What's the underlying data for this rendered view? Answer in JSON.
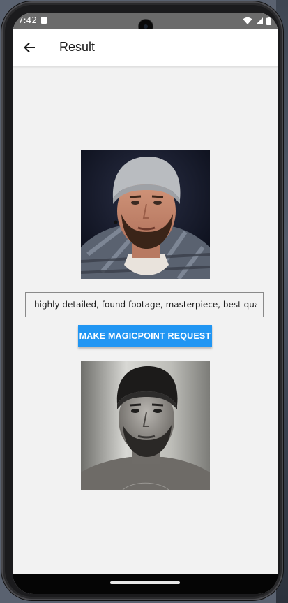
{
  "statusbar": {
    "time": "7:42",
    "icons": [
      "sim-card-icon",
      "wifi-icon",
      "signal-icon",
      "battery-icon"
    ]
  },
  "appbar": {
    "back_icon": "arrow-back-icon",
    "title": "Result"
  },
  "input_photo": {
    "subject": "man wearing a grey beanie and plaid jacket"
  },
  "prompt": {
    "value": "highly detailed, found footage, masterpiece, best quality"
  },
  "request_button": {
    "label": "MAKE MAGICPOINT REQUEST"
  },
  "result_photo": {
    "subject": "black and white portrait of a man wearing a dark beanie"
  },
  "colors": {
    "accent": "#2196f3",
    "background": "#f2f2f2",
    "appbar": "#ffffff",
    "statusbar": "#6b6b6b"
  }
}
